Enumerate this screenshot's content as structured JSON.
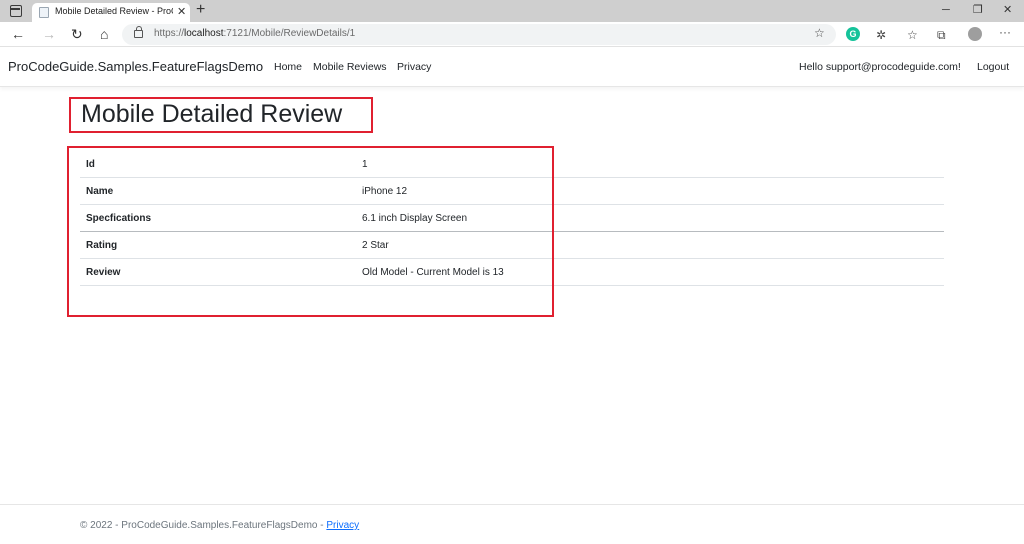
{
  "browser": {
    "tab_title": "Mobile Detailed Review - ProCo",
    "url_prefix": "https://",
    "url_host": "localhost",
    "url_path": ":7121/Mobile/ReviewDetails/1",
    "grammarly_letter": "G"
  },
  "navbar": {
    "brand": "ProCodeGuide.Samples.FeatureFlagsDemo",
    "links": [
      "Home",
      "Mobile Reviews",
      "Privacy"
    ],
    "greeting": "Hello support@procodeguide.com!",
    "logout": "Logout"
  },
  "page": {
    "title": "Mobile Detailed Review",
    "details": [
      {
        "label": "Id",
        "value": "1"
      },
      {
        "label": "Name",
        "value": "iPhone 12"
      },
      {
        "label": "Specfications",
        "value": "6.1 inch Display Screen"
      },
      {
        "label": "Rating",
        "value": "2 Star"
      },
      {
        "label": "Review",
        "value": "Old Model - Current Model is 13"
      }
    ]
  },
  "footer": {
    "text": "© 2022 - ProCodeGuide.Samples.FeatureFlagsDemo - ",
    "link": "Privacy"
  },
  "colors": {
    "highlight_border": "#e02030",
    "link": "#0d6efd",
    "grammarly": "#15c39a"
  }
}
